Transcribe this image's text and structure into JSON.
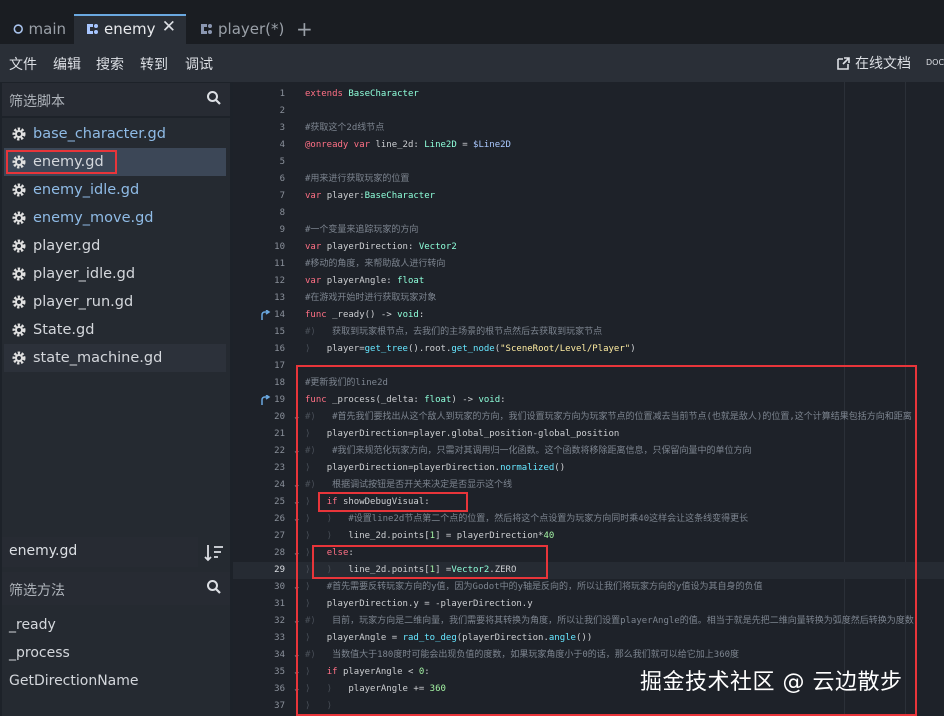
{
  "tabs": [
    {
      "label": "main",
      "icon": "circle-icon",
      "active": false
    },
    {
      "label": "enemy",
      "icon": "script-node-icon",
      "active": true
    },
    {
      "label": "player(*)",
      "icon": "script-node-icon",
      "active": false
    }
  ],
  "tab_add": "+",
  "menu": [
    "文件",
    "编辑",
    "搜索",
    "转到",
    "调试"
  ],
  "online_doc": "在线文档",
  "doc_cut": "DOC",
  "script_filter": {
    "placeholder": "筛选脚本"
  },
  "scripts": [
    {
      "name": "base_character.gd",
      "color": "blue",
      "selected": false
    },
    {
      "name": "enemy.gd",
      "color": "white",
      "selected": true
    },
    {
      "name": "enemy_idle.gd",
      "color": "blue",
      "selected": false
    },
    {
      "name": "enemy_move.gd",
      "color": "blue",
      "selected": false
    },
    {
      "name": "player.gd",
      "color": "white",
      "selected": false
    },
    {
      "name": "player_idle.gd",
      "color": "white",
      "selected": false
    },
    {
      "name": "player_run.gd",
      "color": "white",
      "selected": false
    },
    {
      "name": "State.gd",
      "color": "white",
      "selected": false
    },
    {
      "name": "state_machine.gd",
      "color": "white",
      "selected": false
    }
  ],
  "current_script": "enemy.gd",
  "method_filter": {
    "placeholder": "筛选方法"
  },
  "methods": [
    "_ready",
    "_process",
    "GetDirectionName"
  ],
  "code_lines": [
    {
      "n": "1",
      "t": "extends BaseCharacter"
    },
    {
      "n": "2",
      "t": ""
    },
    {
      "n": "3",
      "t": "#获取这个2d线节点"
    },
    {
      "n": "4",
      "t": "@onready var line_2d: Line2D = $Line2D"
    },
    {
      "n": "5",
      "t": ""
    },
    {
      "n": "6",
      "t": "#用来进行获取玩家的位置"
    },
    {
      "n": "7",
      "t": "var player:BaseCharacter"
    },
    {
      "n": "8",
      "t": ""
    },
    {
      "n": "9",
      "t": "#一个变量来追踪玩家的方向"
    },
    {
      "n": "10",
      "t": "var playerDirection: Vector2"
    },
    {
      "n": "11",
      "t": "#移动的角度，来帮助敌人进行转向"
    },
    {
      "n": "12",
      "t": "var playerAngle: float"
    },
    {
      "n": "13",
      "t": "#在游戏开始时进行获取玩家对象"
    },
    {
      "n": "14",
      "t": "func _ready() -> void:"
    },
    {
      "n": "15",
      "t": "#⟩   获取到玩家根节点，去我们的主场景的根节点然后去获取到玩家节点"
    },
    {
      "n": "16",
      "t": "⟩   player=get_tree().root.get_node(\"SceneRoot/Level/Player\")"
    },
    {
      "n": "17",
      "t": ""
    },
    {
      "n": "18",
      "t": "#更新我们的line2d"
    },
    {
      "n": "19",
      "t": "func _process(_delta: float) -> void:"
    },
    {
      "n": "20",
      "t": "#⟩   #首先我们要找出从这个敌人到玩家的方向，我们设置玩家方向为玩家节点的位置减去当前节点(也就是敌人)的位置,这个计算结果包括方向和距离"
    },
    {
      "n": "21",
      "t": "⟩   playerDirection=player.global_position-global_position"
    },
    {
      "n": "22",
      "t": "#⟩   #我们来规范化玩家方向，只需对其调用归一化函数。这个函数将移除距离信息，只保留向量中的单位方向"
    },
    {
      "n": "23",
      "t": "⟩   playerDirection=playerDirection.normalized()"
    },
    {
      "n": "24",
      "t": "#⟩   根据调试按钮是否开关来决定是否显示这个线"
    },
    {
      "n": "25",
      "t": "⟩   if showDebugVisual:"
    },
    {
      "n": "26",
      "t": "⟩   ⟩   #设置line2d节点第二个点的位置，然后将这个点设置为玩家方向同时乘40这样会让这条线变得更长"
    },
    {
      "n": "27",
      "t": "⟩   ⟩   line_2d.points[1] = playerDirection*40"
    },
    {
      "n": "28",
      "t": "⟩   else:"
    },
    {
      "n": "29",
      "t": "⟩   ⟩   line_2d.points[1] =Vector2.ZERO"
    },
    {
      "n": "30",
      "t": "⟩   #首先需要反转玩家方向的y值，因为Godot中的y轴是反向的，所以让我们将玩家方向的y值设为其自身的负值"
    },
    {
      "n": "31",
      "t": "⟩   playerDirection.y = -playerDirection.y"
    },
    {
      "n": "32",
      "t": "#⟩   目前，玩家方向是二维向量，我们需要将其转换为角度，所以让我们设置playerAngle的值。相当于就是先把二维向量转换为弧度然后转换为度数"
    },
    {
      "n": "33",
      "t": "⟩   playerAngle = rad_to_deg(playerDirection.angle())"
    },
    {
      "n": "34",
      "t": "#⟩   当数值大于180度时可能会出现负值的度数，如果玩家角度小于0的话，那么我们就可以给它加上360度"
    },
    {
      "n": "35",
      "t": "⟩   if playerAngle < 0:"
    },
    {
      "n": "36",
      "t": "⟩   ⟩   playerAngle += 360"
    },
    {
      "n": "37",
      "t": "⟩   ⟩"
    }
  ],
  "watermark": "掘金技术社区 @ 云边散步",
  "colors": {
    "highlight_box": "#e8353a",
    "keyword": "#ff7085",
    "type": "#8effda",
    "function": "#66e6ff",
    "string": "#ffeda1",
    "comment": "#7d8590"
  }
}
